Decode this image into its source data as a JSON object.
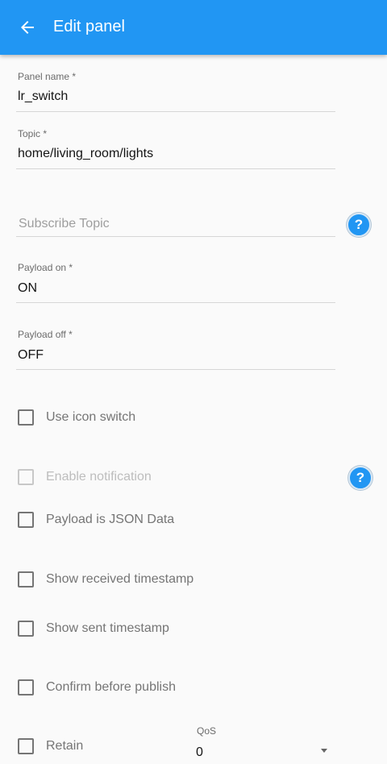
{
  "appbar": {
    "title": "Edit panel",
    "back_icon": "arrow-left-icon",
    "color": "#2196f3"
  },
  "fields": {
    "panel_name": {
      "label": "Panel name *",
      "value": "lr_switch"
    },
    "topic": {
      "label": "Topic *",
      "value": "home/living_room/lights"
    },
    "subscribe_topic": {
      "placeholder": "Subscribe Topic"
    },
    "payload_on": {
      "label": "Payload on *",
      "value": "ON"
    },
    "payload_off": {
      "label": "Payload off *",
      "value": "OFF"
    }
  },
  "help_icon": {
    "name": "help-icon",
    "glyph": "?"
  },
  "checkboxes": {
    "use_icon_switch": {
      "label": "Use icon switch",
      "checked": false
    },
    "enable_notification": {
      "label": "Enable notification",
      "checked": false,
      "disabled": true
    },
    "payload_json": {
      "label": "Payload is JSON Data",
      "checked": false
    },
    "show_received_timestamp": {
      "label": "Show received timestamp",
      "checked": false
    },
    "show_sent_timestamp": {
      "label": "Show sent timestamp",
      "checked": false
    },
    "confirm_before_publish": {
      "label": "Confirm before publish",
      "checked": false
    },
    "retain": {
      "label": "Retain",
      "checked": false
    }
  },
  "qos": {
    "label": "QoS",
    "value": "0"
  }
}
